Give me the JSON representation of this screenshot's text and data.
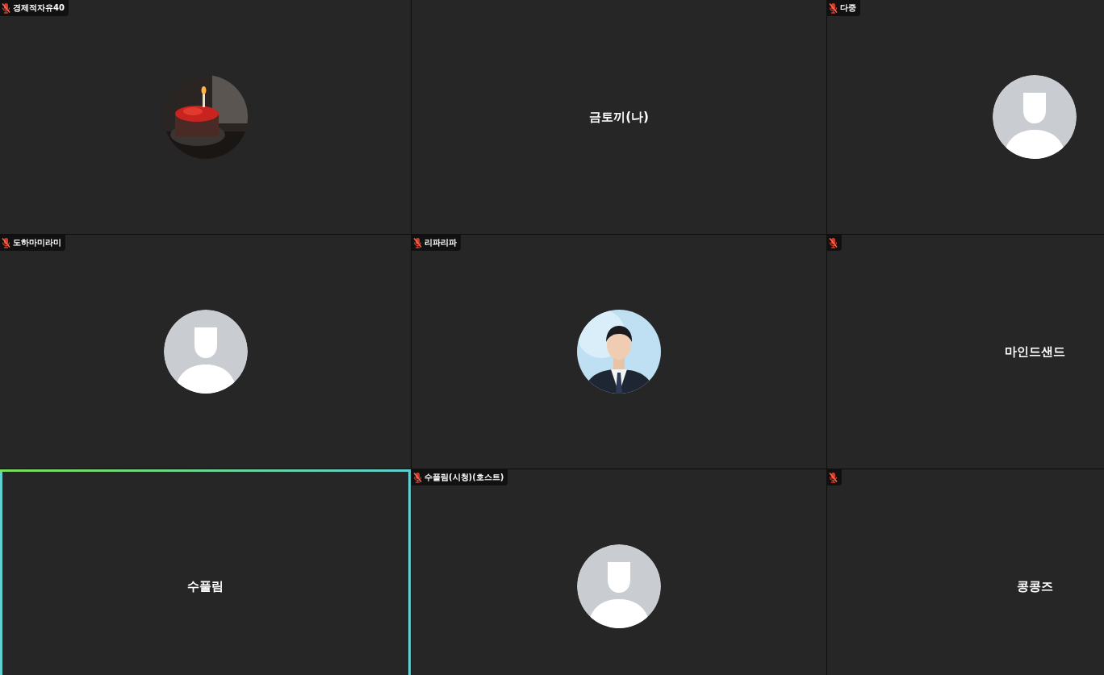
{
  "tiles": [
    {
      "label": "경제적자유40",
      "muted": true,
      "speaking": false,
      "kind": "picture"
    },
    {
      "name": "금토끼(나)",
      "speaking": false,
      "kind": "name"
    },
    {
      "label": "다중",
      "muted": true,
      "speaking": false,
      "kind": "placeholder"
    },
    {
      "label": "도하마미라미",
      "muted": true,
      "speaking": false,
      "kind": "placeholder"
    },
    {
      "label": "리파리파",
      "muted": true,
      "speaking": false,
      "kind": "picture"
    },
    {
      "name": "마인드샌드",
      "muted": true,
      "speaking": false,
      "kind": "name"
    },
    {
      "name": "수풀림",
      "speaking": true,
      "kind": "name"
    },
    {
      "label": "수풀림(시청)(호스트)",
      "muted": true,
      "speaking": false,
      "kind": "placeholder"
    },
    {
      "name": "콩콩즈",
      "muted": true,
      "speaking": false,
      "kind": "name"
    }
  ]
}
